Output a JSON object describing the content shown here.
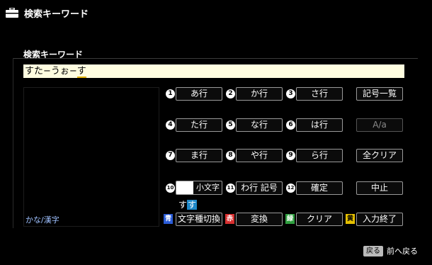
{
  "header": {
    "title": "検索キーワード",
    "icon": "toolbox-icon"
  },
  "panel": {
    "title": "検索キーワード"
  },
  "input": {
    "committed": "すた−うぉ−",
    "composing": "す"
  },
  "mode_label": "かな/漢字",
  "keypad": [
    {
      "num": "1",
      "label": "あ行"
    },
    {
      "num": "2",
      "label": "か行"
    },
    {
      "num": "3",
      "label": "さ行"
    },
    {
      "num": "4",
      "label": "た行"
    },
    {
      "num": "5",
      "label": "な行"
    },
    {
      "num": "6",
      "label": "は行"
    },
    {
      "num": "7",
      "label": "ま行"
    },
    {
      "num": "8",
      "label": "や行"
    },
    {
      "num": "9",
      "label": "ら行"
    },
    {
      "num": "10",
      "label": "小文字"
    },
    {
      "num": "11",
      "label": "わ行 記号"
    },
    {
      "num": "12",
      "label": "確定"
    }
  ],
  "side_buttons": {
    "symbols": "記号一覧",
    "case": "A/a",
    "clear_all": "全クリア",
    "cancel": "中止"
  },
  "candidate": {
    "text": "す",
    "highlight": "す"
  },
  "color_keys": {
    "blue": {
      "key": "青",
      "label": "文字種切換"
    },
    "red": {
      "key": "赤",
      "label": "変換"
    },
    "green": {
      "key": "緑",
      "label": "クリア"
    },
    "yellow": {
      "key": "黄",
      "label": "入力終了"
    }
  },
  "footer": {
    "back_button": "戻る",
    "back_label": "前へ戻る"
  }
}
